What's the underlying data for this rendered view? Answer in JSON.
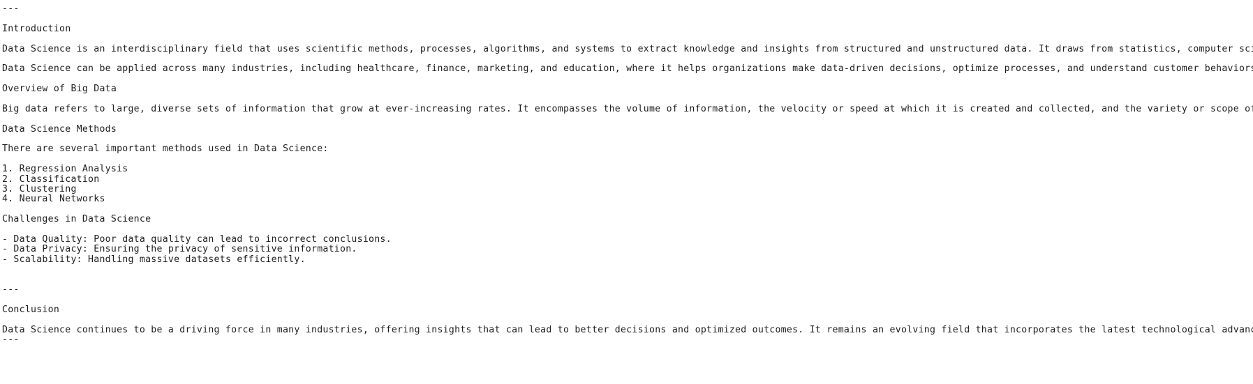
{
  "document": {
    "type": "plain-text",
    "font": "monospace",
    "background_color": "#ffffff",
    "text_color": "#1d1d1d",
    "lines": [
      {
        "id": "rule-top",
        "kind": "rule",
        "text": "---"
      },
      {
        "id": "blank-1",
        "kind": "blank",
        "text": ""
      },
      {
        "id": "heading-intro",
        "kind": "heading",
        "text": "Introduction"
      },
      {
        "id": "blank-2",
        "kind": "blank",
        "text": ""
      },
      {
        "id": "para-intro-1",
        "kind": "para",
        "text": "Data Science is an interdisciplinary field that uses scientific methods, processes, algorithms, and systems to extract knowledge and insights from structured and unstructured data. It draws from statistics, computer science, machine learning, and various other fields."
      },
      {
        "id": "blank-3",
        "kind": "blank",
        "text": ""
      },
      {
        "id": "para-intro-2",
        "kind": "para",
        "text": "Data Science can be applied across many industries, including healthcare, finance, marketing, and education, where it helps organizations make data-driven decisions, optimize processes, and understand customer behaviors."
      },
      {
        "id": "blank-4",
        "kind": "blank",
        "text": ""
      },
      {
        "id": "heading-bigdata",
        "kind": "heading",
        "text": "Overview of Big Data"
      },
      {
        "id": "blank-5",
        "kind": "blank",
        "text": ""
      },
      {
        "id": "para-bigdata",
        "kind": "para",
        "text": "Big data refers to large, diverse sets of information that grow at ever-increasing rates. It encompasses the volume of information, the velocity or speed at which it is created and collected, and the variety or scope of the data points being covered."
      },
      {
        "id": "blank-6",
        "kind": "blank",
        "text": ""
      },
      {
        "id": "heading-methods",
        "kind": "heading",
        "text": "Data Science Methods"
      },
      {
        "id": "blank-7",
        "kind": "blank",
        "text": ""
      },
      {
        "id": "para-methods",
        "kind": "para",
        "text": "There are several important methods used in Data Science:"
      },
      {
        "id": "blank-8",
        "kind": "blank",
        "text": ""
      },
      {
        "id": "item-1",
        "kind": "item",
        "text": "1. Regression Analysis"
      },
      {
        "id": "item-2",
        "kind": "item",
        "text": "2. Classification"
      },
      {
        "id": "item-3",
        "kind": "item",
        "text": "3. Clustering"
      },
      {
        "id": "item-4",
        "kind": "item",
        "text": "4. Neural Networks"
      },
      {
        "id": "blank-9",
        "kind": "blank",
        "text": ""
      },
      {
        "id": "heading-chall",
        "kind": "heading",
        "text": "Challenges in Data Science"
      },
      {
        "id": "blank-10",
        "kind": "blank",
        "text": ""
      },
      {
        "id": "bullet-1",
        "kind": "bullet",
        "text": "- Data Quality: Poor data quality can lead to incorrect conclusions."
      },
      {
        "id": "bullet-2",
        "kind": "bullet",
        "text": "- Data Privacy: Ensuring the privacy of sensitive information."
      },
      {
        "id": "bullet-3",
        "kind": "bullet",
        "text": "- Scalability: Handling massive datasets efficiently."
      },
      {
        "id": "blank-11",
        "kind": "blank",
        "text": ""
      },
      {
        "id": "blank-12",
        "kind": "blank",
        "text": ""
      },
      {
        "id": "rule-mid",
        "kind": "rule",
        "text": "---"
      },
      {
        "id": "blank-13",
        "kind": "blank",
        "text": ""
      },
      {
        "id": "heading-concl",
        "kind": "heading",
        "text": "Conclusion"
      },
      {
        "id": "blank-14",
        "kind": "blank",
        "text": ""
      },
      {
        "id": "para-concl",
        "kind": "para",
        "text": "Data Science continues to be a driving force in many industries, offering insights that can lead to better decisions and optimized outcomes. It remains an evolving field that incorporates the latest technological advancements."
      },
      {
        "id": "rule-bottom",
        "kind": "rule",
        "text": "---"
      }
    ]
  }
}
